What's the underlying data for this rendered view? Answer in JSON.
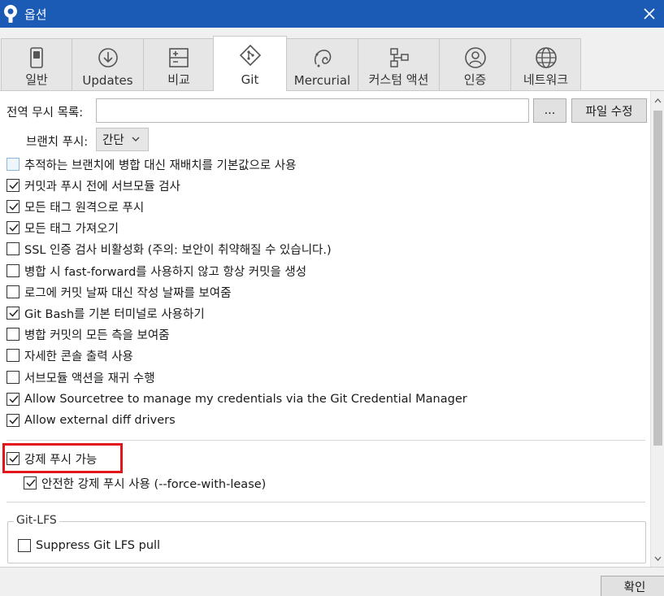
{
  "window": {
    "title": "옵션",
    "app_icon": "sourcetree-logo-icon",
    "close_icon": "close-icon"
  },
  "tabs": [
    {
      "label": "일반",
      "icon": "switch-icon",
      "active": false
    },
    {
      "label": "Updates",
      "icon": "download-icon",
      "active": false
    },
    {
      "label": "비교",
      "icon": "diff-icon",
      "active": false
    },
    {
      "label": "Git",
      "icon": "git-icon",
      "active": true
    },
    {
      "label": "Mercurial",
      "icon": "mercurial-icon",
      "active": false
    },
    {
      "label": "커스텀 액션",
      "icon": "custom-actions-icon",
      "active": false
    },
    {
      "label": "인증",
      "icon": "user-icon",
      "active": false
    },
    {
      "label": "네트워크",
      "icon": "globe-icon",
      "active": false
    }
  ],
  "git": {
    "global_ignore_label": "전역 무시 목록:",
    "global_ignore_value": "",
    "browse_button": "...",
    "edit_file_button": "파일 수정",
    "branch_push_label": "브랜치 푸시:",
    "branch_push_value": "간단",
    "options": [
      {
        "label": "추적하는 브랜치에 병합 대신 재배치를 기본값으로 사용",
        "checked": false
      },
      {
        "label": "커밋과 푸시 전에 서브모듈 검사",
        "checked": true
      },
      {
        "label": "모든 태그 원격으로 푸시",
        "checked": true
      },
      {
        "label": "모든 태그 가져오기",
        "checked": true
      },
      {
        "label": "SSL 인증 검사 비활성화 (주의: 보안이 취약해질 수 있습니다.)",
        "checked": false
      },
      {
        "label": "병합 시 fast-forward를 사용하지 않고 항상 커밋을 생성",
        "checked": false
      },
      {
        "label": "로그에 커밋 날짜 대신 작성 날짜를 보여줌",
        "checked": false
      },
      {
        "label": "Git Bash를 기본 터미널로 사용하기",
        "checked": true
      },
      {
        "label": "병합 커밋의 모든 측을 보여줌",
        "checked": false
      },
      {
        "label": "자세한 콘솔 출력 사용",
        "checked": false
      },
      {
        "label": "서브모듈 액션을 재귀 수행",
        "checked": false
      },
      {
        "label": "Allow Sourcetree to manage my credentials via the Git Credential Manager",
        "checked": true
      },
      {
        "label": "Allow external diff drivers",
        "checked": true
      }
    ],
    "force_push": {
      "label": "강제 푸시 가능",
      "checked": true
    },
    "force_with_lease": {
      "label": "안전한 강제 푸시 사용 (--force-with-lease)",
      "checked": true
    },
    "lfs_group": {
      "legend": "Git-LFS",
      "suppress_pull": {
        "label": "Suppress Git LFS pull",
        "checked": false
      }
    }
  },
  "footer": {
    "ok_button": "확인"
  },
  "colors": {
    "titlebar": "#1b5bb5",
    "highlight": "#e2151b"
  }
}
